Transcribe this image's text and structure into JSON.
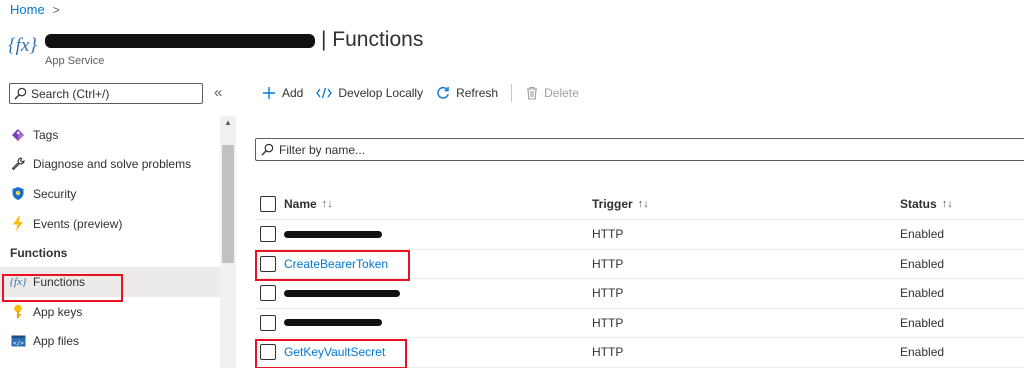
{
  "breadcrumb": {
    "home": "Home",
    "separator": ">"
  },
  "header": {
    "title": "| Functions",
    "subtitle": "App Service"
  },
  "sidebar": {
    "search_placeholder": "Search (Ctrl+/)",
    "collapse": "«",
    "items_top": [
      {
        "label": "Tags",
        "icon": "tag-icon"
      },
      {
        "label": "Diagnose and solve problems",
        "icon": "wrench-icon"
      },
      {
        "label": "Security",
        "icon": "shield-icon"
      },
      {
        "label": "Events (preview)",
        "icon": "lightning-icon"
      }
    ],
    "section": "Functions",
    "items_bottom": [
      {
        "label": "Functions",
        "icon": "fx-icon",
        "active": true
      },
      {
        "label": "App keys",
        "icon": "key-icon"
      },
      {
        "label": "App files",
        "icon": "code-file-icon"
      }
    ]
  },
  "toolbar": {
    "add": "Add",
    "develop": "Develop Locally",
    "refresh": "Refresh",
    "delete": "Delete"
  },
  "filter": {
    "placeholder": "Filter by name..."
  },
  "table": {
    "headers": {
      "name": "Name",
      "trigger": "Trigger",
      "status": "Status"
    },
    "sort_glyph": "↑↓",
    "rows": [
      {
        "name": "",
        "redacted": true,
        "trigger": "HTTP",
        "status": "Enabled"
      },
      {
        "name": "CreateBearerToken",
        "redacted": false,
        "trigger": "HTTP",
        "status": "Enabled"
      },
      {
        "name": "",
        "redacted": true,
        "trigger": "HTTP",
        "status": "Enabled"
      },
      {
        "name": "",
        "redacted": true,
        "trigger": "HTTP",
        "status": "Enabled"
      },
      {
        "name": "GetKeyVaultSecret",
        "redacted": false,
        "trigger": "HTTP",
        "status": "Enabled"
      }
    ]
  },
  "colors": {
    "accent": "#0078d4",
    "highlight_box": "#e81123"
  }
}
